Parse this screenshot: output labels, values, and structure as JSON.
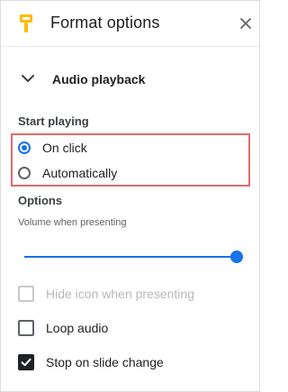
{
  "header": {
    "title": "Format options",
    "icon": "paint-roller-icon",
    "accent_color": "#fbbc04",
    "close_icon": "close-icon"
  },
  "section": {
    "label": "Audio playback",
    "icon": "chevron-down-icon",
    "expanded": true
  },
  "start_playing": {
    "label": "Start playing",
    "options": [
      {
        "label": "On click",
        "selected": true
      },
      {
        "label": "Automatically",
        "selected": false
      }
    ],
    "highlight_color": "#e36a6a"
  },
  "options": {
    "label": "Options",
    "volume_label": "Volume when presenting",
    "volume_level": 1.0,
    "accent_color": "#1a73e8",
    "checkboxes": [
      {
        "label": "Hide icon when presenting",
        "checked": false,
        "disabled": true
      },
      {
        "label": "Loop audio",
        "checked": false,
        "disabled": false
      },
      {
        "label": "Stop on slide change",
        "checked": true,
        "disabled": false
      }
    ]
  }
}
